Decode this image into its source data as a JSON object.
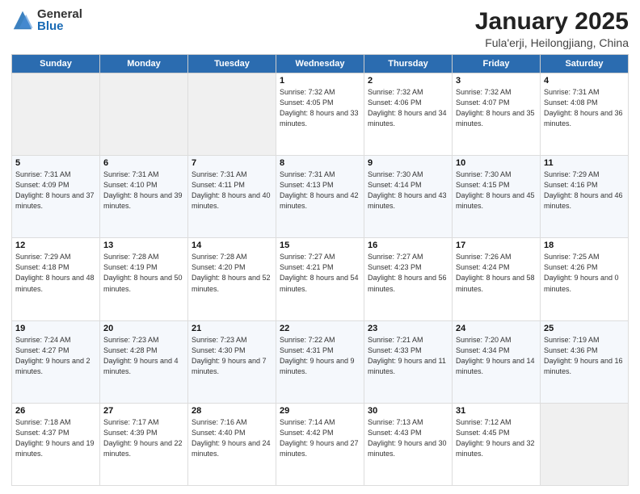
{
  "header": {
    "logo_general": "General",
    "logo_blue": "Blue",
    "title": "January 2025",
    "location": "Fula'erji, Heilongjiang, China"
  },
  "weekdays": [
    "Sunday",
    "Monday",
    "Tuesday",
    "Wednesday",
    "Thursday",
    "Friday",
    "Saturday"
  ],
  "weeks": [
    [
      {
        "day": "",
        "info": ""
      },
      {
        "day": "",
        "info": ""
      },
      {
        "day": "",
        "info": ""
      },
      {
        "day": "1",
        "info": "Sunrise: 7:32 AM\nSunset: 4:05 PM\nDaylight: 8 hours\nand 33 minutes."
      },
      {
        "day": "2",
        "info": "Sunrise: 7:32 AM\nSunset: 4:06 PM\nDaylight: 8 hours\nand 34 minutes."
      },
      {
        "day": "3",
        "info": "Sunrise: 7:32 AM\nSunset: 4:07 PM\nDaylight: 8 hours\nand 35 minutes."
      },
      {
        "day": "4",
        "info": "Sunrise: 7:31 AM\nSunset: 4:08 PM\nDaylight: 8 hours\nand 36 minutes."
      }
    ],
    [
      {
        "day": "5",
        "info": "Sunrise: 7:31 AM\nSunset: 4:09 PM\nDaylight: 8 hours\nand 37 minutes."
      },
      {
        "day": "6",
        "info": "Sunrise: 7:31 AM\nSunset: 4:10 PM\nDaylight: 8 hours\nand 39 minutes."
      },
      {
        "day": "7",
        "info": "Sunrise: 7:31 AM\nSunset: 4:11 PM\nDaylight: 8 hours\nand 40 minutes."
      },
      {
        "day": "8",
        "info": "Sunrise: 7:31 AM\nSunset: 4:13 PM\nDaylight: 8 hours\nand 42 minutes."
      },
      {
        "day": "9",
        "info": "Sunrise: 7:30 AM\nSunset: 4:14 PM\nDaylight: 8 hours\nand 43 minutes."
      },
      {
        "day": "10",
        "info": "Sunrise: 7:30 AM\nSunset: 4:15 PM\nDaylight: 8 hours\nand 45 minutes."
      },
      {
        "day": "11",
        "info": "Sunrise: 7:29 AM\nSunset: 4:16 PM\nDaylight: 8 hours\nand 46 minutes."
      }
    ],
    [
      {
        "day": "12",
        "info": "Sunrise: 7:29 AM\nSunset: 4:18 PM\nDaylight: 8 hours\nand 48 minutes."
      },
      {
        "day": "13",
        "info": "Sunrise: 7:28 AM\nSunset: 4:19 PM\nDaylight: 8 hours\nand 50 minutes."
      },
      {
        "day": "14",
        "info": "Sunrise: 7:28 AM\nSunset: 4:20 PM\nDaylight: 8 hours\nand 52 minutes."
      },
      {
        "day": "15",
        "info": "Sunrise: 7:27 AM\nSunset: 4:21 PM\nDaylight: 8 hours\nand 54 minutes."
      },
      {
        "day": "16",
        "info": "Sunrise: 7:27 AM\nSunset: 4:23 PM\nDaylight: 8 hours\nand 56 minutes."
      },
      {
        "day": "17",
        "info": "Sunrise: 7:26 AM\nSunset: 4:24 PM\nDaylight: 8 hours\nand 58 minutes."
      },
      {
        "day": "18",
        "info": "Sunrise: 7:25 AM\nSunset: 4:26 PM\nDaylight: 9 hours\nand 0 minutes."
      }
    ],
    [
      {
        "day": "19",
        "info": "Sunrise: 7:24 AM\nSunset: 4:27 PM\nDaylight: 9 hours\nand 2 minutes."
      },
      {
        "day": "20",
        "info": "Sunrise: 7:23 AM\nSunset: 4:28 PM\nDaylight: 9 hours\nand 4 minutes."
      },
      {
        "day": "21",
        "info": "Sunrise: 7:23 AM\nSunset: 4:30 PM\nDaylight: 9 hours\nand 7 minutes."
      },
      {
        "day": "22",
        "info": "Sunrise: 7:22 AM\nSunset: 4:31 PM\nDaylight: 9 hours\nand 9 minutes."
      },
      {
        "day": "23",
        "info": "Sunrise: 7:21 AM\nSunset: 4:33 PM\nDaylight: 9 hours\nand 11 minutes."
      },
      {
        "day": "24",
        "info": "Sunrise: 7:20 AM\nSunset: 4:34 PM\nDaylight: 9 hours\nand 14 minutes."
      },
      {
        "day": "25",
        "info": "Sunrise: 7:19 AM\nSunset: 4:36 PM\nDaylight: 9 hours\nand 16 minutes."
      }
    ],
    [
      {
        "day": "26",
        "info": "Sunrise: 7:18 AM\nSunset: 4:37 PM\nDaylight: 9 hours\nand 19 minutes."
      },
      {
        "day": "27",
        "info": "Sunrise: 7:17 AM\nSunset: 4:39 PM\nDaylight: 9 hours\nand 22 minutes."
      },
      {
        "day": "28",
        "info": "Sunrise: 7:16 AM\nSunset: 4:40 PM\nDaylight: 9 hours\nand 24 minutes."
      },
      {
        "day": "29",
        "info": "Sunrise: 7:14 AM\nSunset: 4:42 PM\nDaylight: 9 hours\nand 27 minutes."
      },
      {
        "day": "30",
        "info": "Sunrise: 7:13 AM\nSunset: 4:43 PM\nDaylight: 9 hours\nand 30 minutes."
      },
      {
        "day": "31",
        "info": "Sunrise: 7:12 AM\nSunset: 4:45 PM\nDaylight: 9 hours\nand 32 minutes."
      },
      {
        "day": "",
        "info": ""
      }
    ]
  ]
}
